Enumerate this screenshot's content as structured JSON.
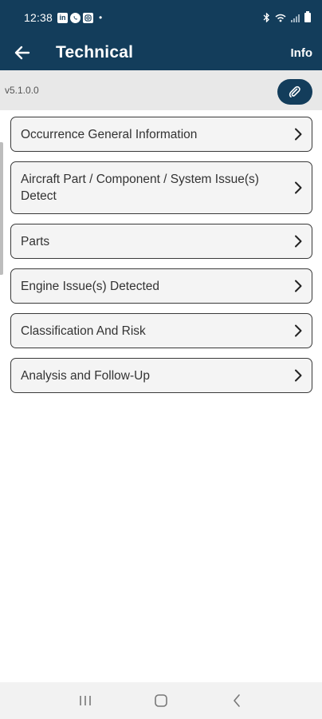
{
  "status_bar": {
    "time": "12:38",
    "app_icons": [
      "linkedin-icon",
      "whatsapp-icon",
      "instagram-icon"
    ],
    "dot": "•",
    "right_icons": [
      "bluetooth-icon",
      "wifi-icon",
      "signal-icon",
      "battery-icon"
    ]
  },
  "app_bar": {
    "title": "Technical",
    "info_label": "Info",
    "background": "#133d5b"
  },
  "version_bar": {
    "version": "v5.1.0.0",
    "attach_icon": "paperclip-icon"
  },
  "sections": [
    {
      "label": "Occurrence General Information"
    },
    {
      "label": "Aircraft Part / Component / System Issue(s) Detect"
    },
    {
      "label": "Parts"
    },
    {
      "label": "Engine Issue(s) Detected"
    },
    {
      "label": "Classification And Risk"
    },
    {
      "label": "Analysis and Follow-Up"
    }
  ],
  "nav_bar": {
    "buttons": [
      "recent-apps-icon",
      "home-icon",
      "back-icon"
    ]
  }
}
